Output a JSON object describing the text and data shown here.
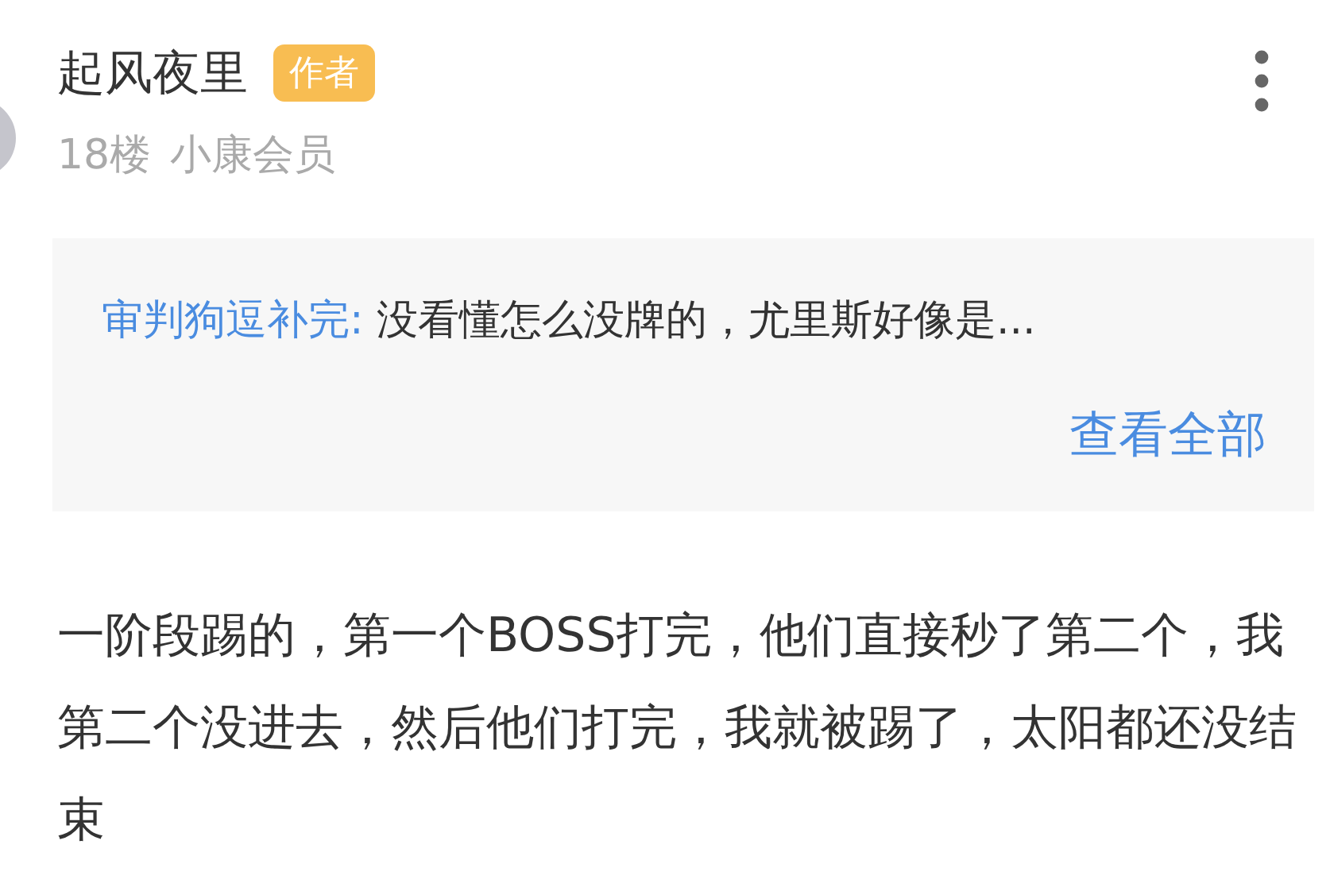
{
  "post": {
    "author": "起风夜里",
    "badge": "作者",
    "floor": "18楼",
    "rank": "小康会员"
  },
  "quote": {
    "user": "审判狗逗补完:",
    "text": "没看懂怎么没牌的，尤里斯好像是...",
    "more": "查看全部"
  },
  "body": "一阶段踢的，第一个BOSS打完，他们直接秒了第二个，我第二个没进去，然后他们打完，我就被踢了，太阳都还没结束"
}
